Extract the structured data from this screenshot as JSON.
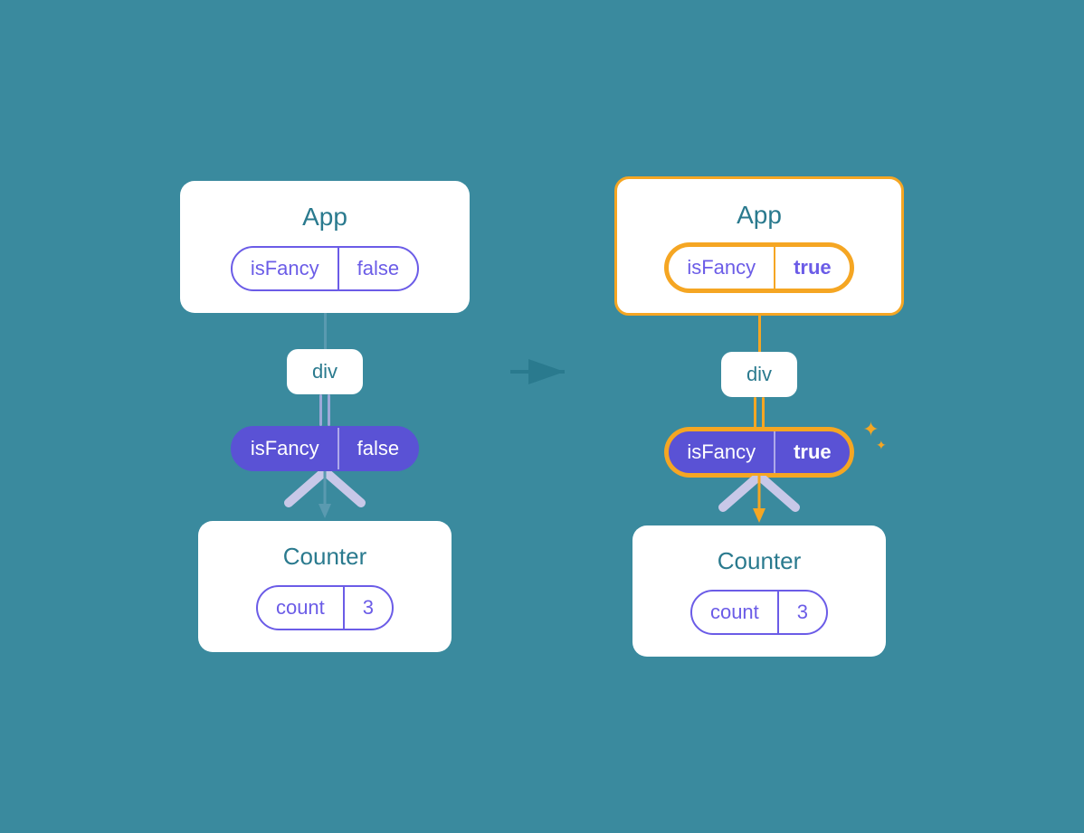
{
  "left_diagram": {
    "app_title": "App",
    "prop_key": "isFancy",
    "prop_value": "false",
    "div_label": "div",
    "dark_pill_key": "isFancy",
    "dark_pill_value": "false",
    "counter_title": "Counter",
    "count_key": "count",
    "count_value": "3",
    "highlighted": false
  },
  "right_diagram": {
    "app_title": "App",
    "prop_key": "isFancy",
    "prop_value": "true",
    "div_label": "div",
    "dark_pill_key": "isFancy",
    "dark_pill_value": "true",
    "counter_title": "Counter",
    "count_key": "count",
    "count_value": "3",
    "highlighted": true
  },
  "arrow": "→",
  "sparkle_char": "✦"
}
